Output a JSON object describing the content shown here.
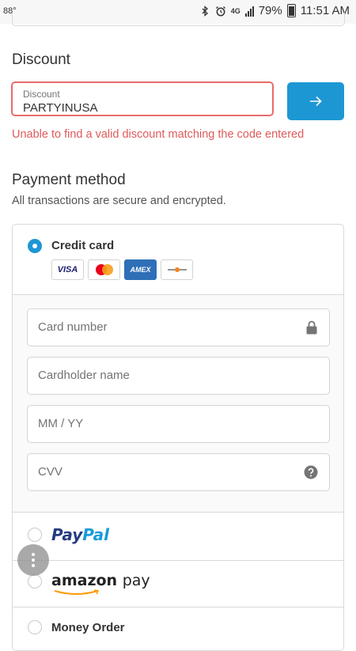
{
  "status_bar": {
    "temperature": "88°",
    "network": "4G",
    "battery": "79%",
    "time": "11:51 AM"
  },
  "discount": {
    "heading": "Discount",
    "field_label": "Discount",
    "field_value": "PARTYINUSA",
    "error": "Unable to find a valid discount matching the code entered"
  },
  "payment": {
    "heading": "Payment method",
    "subtitle": "All transactions are secure and encrypted.",
    "methods": {
      "credit_card": {
        "label": "Credit card",
        "selected": true,
        "logos": [
          "VISA",
          "Mastercard",
          "AMEX",
          "Discover"
        ]
      },
      "paypal": {
        "label_part1": "Pay",
        "label_part2": "Pal",
        "selected": false
      },
      "amazon_pay": {
        "label_part1": "amazon",
        "label_part2": "pay",
        "selected": false
      },
      "money_order": {
        "label": "Money Order",
        "selected": false
      }
    },
    "card_form": {
      "card_number_placeholder": "Card number",
      "cardholder_placeholder": "Cardholder name",
      "expiry_placeholder": "MM / YY",
      "cvv_placeholder": "CVV"
    }
  },
  "colors": {
    "accent": "#1d97d4",
    "error": "#e05a5a"
  },
  "icons": {
    "apply": "arrow-right-icon",
    "card_number_trailing": "lock-icon",
    "cvv_trailing": "help-icon",
    "fab": "more-vertical-icon"
  }
}
